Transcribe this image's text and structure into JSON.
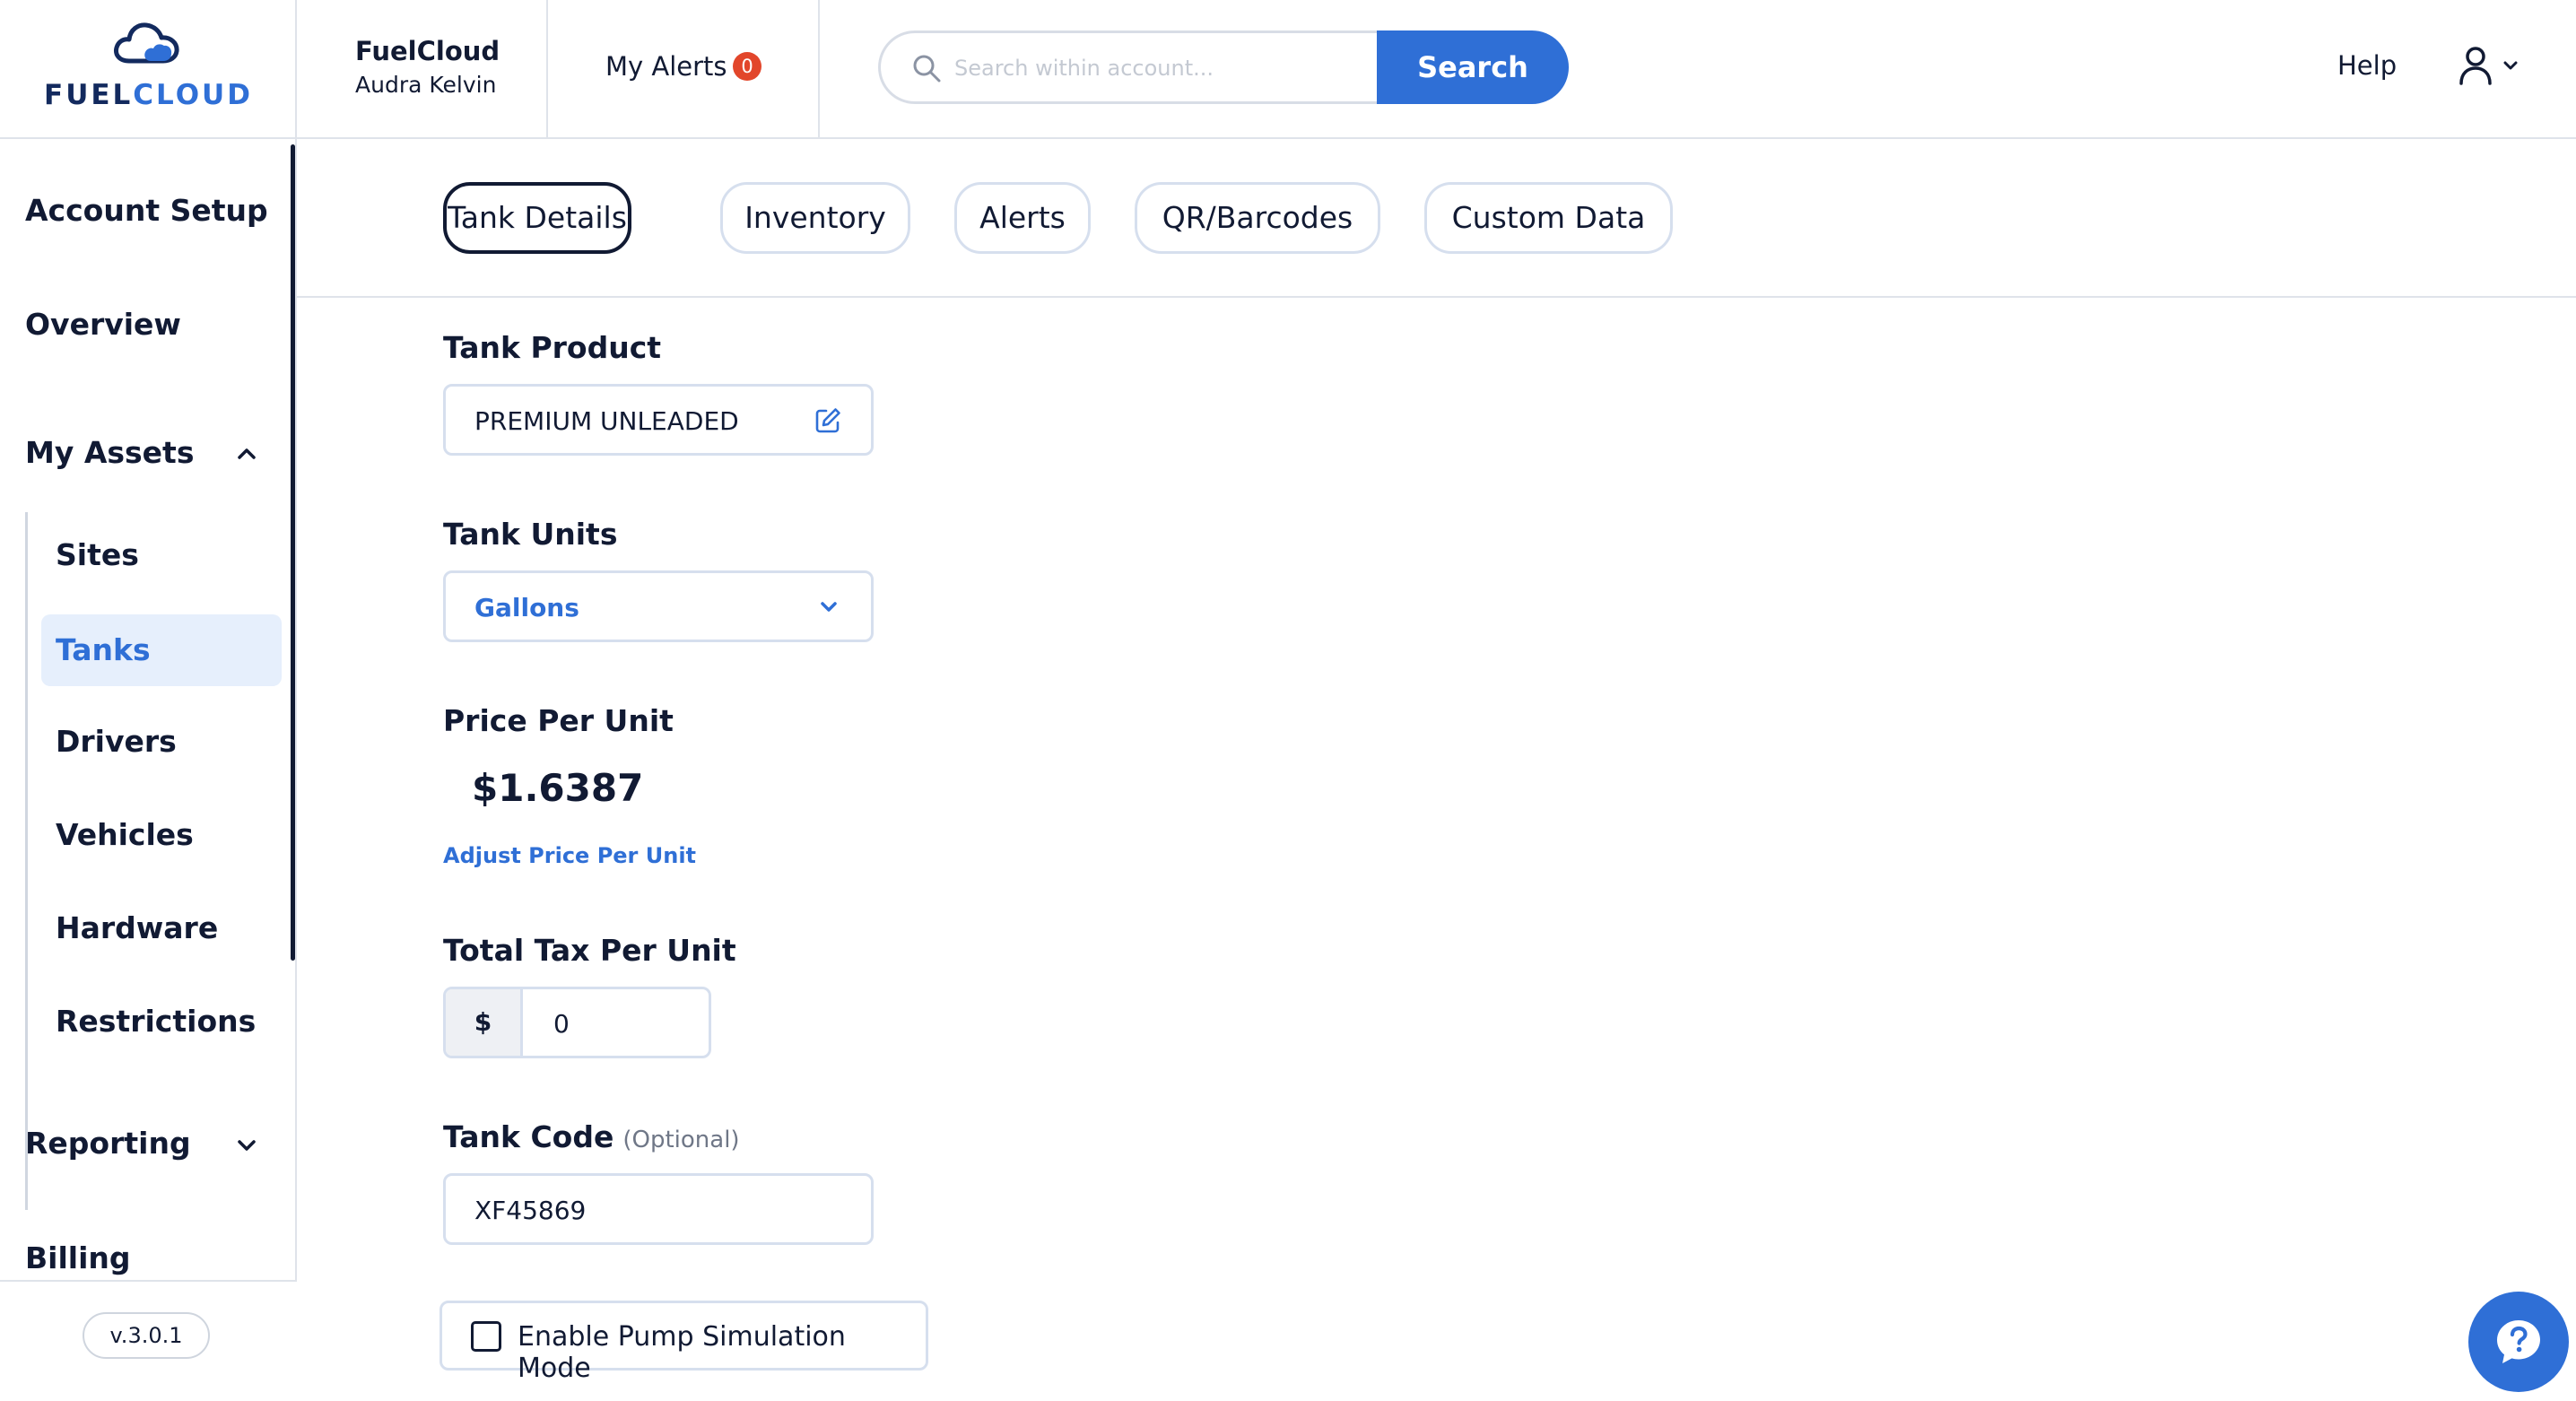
{
  "brand": {
    "logo_word_fuel": "FUEL",
    "logo_word_cloud": "CLOUD"
  },
  "header": {
    "account_name": "FuelCloud",
    "account_user": "Audra Kelvin",
    "alerts_label": "My Alerts",
    "alerts_count": "0",
    "search_placeholder": "Search within account...",
    "search_value": "",
    "search_button": "Search",
    "help_label": "Help",
    "user_icon": "user-icon",
    "search_icon": "search-icon"
  },
  "sidebar": {
    "account_setup": "Account Setup",
    "overview": "Overview",
    "my_assets": "My Assets",
    "assets_items": [
      {
        "label": "Sites"
      },
      {
        "label": "Tanks"
      },
      {
        "label": "Drivers"
      },
      {
        "label": "Vehicles"
      },
      {
        "label": "Hardware"
      },
      {
        "label": "Restrictions"
      }
    ],
    "active_item": "Tanks",
    "reporting": "Reporting",
    "billing": "Billing",
    "version": "v.3.0.1"
  },
  "tabs": [
    {
      "label": "Tank Details",
      "active": true
    },
    {
      "label": "Inventory"
    },
    {
      "label": "Alerts"
    },
    {
      "label": "QR/Barcodes"
    },
    {
      "label": "Custom Data"
    }
  ],
  "form": {
    "tank_product_label": "Tank Product",
    "tank_product_value": "PREMIUM UNLEADED",
    "tank_units_label": "Tank Units",
    "tank_units_value": "Gallons",
    "price_label": "Price Per Unit",
    "price_value": "$1.6387",
    "adjust_price_link": "Adjust Price Per Unit",
    "tax_label": "Total Tax Per Unit",
    "tax_prefix": "$",
    "tax_value": "0",
    "tank_code_label": "Tank Code",
    "tank_code_optional": "(Optional)",
    "tank_code_value": "XF45869",
    "pump_sim_label": "Enable Pump Simulation Mode",
    "pump_sim_checked": false
  },
  "colors": {
    "accent": "#2f6fd6",
    "navy": "#132a5e",
    "badge": "#e2462b",
    "active_bg": "#e6effc"
  }
}
